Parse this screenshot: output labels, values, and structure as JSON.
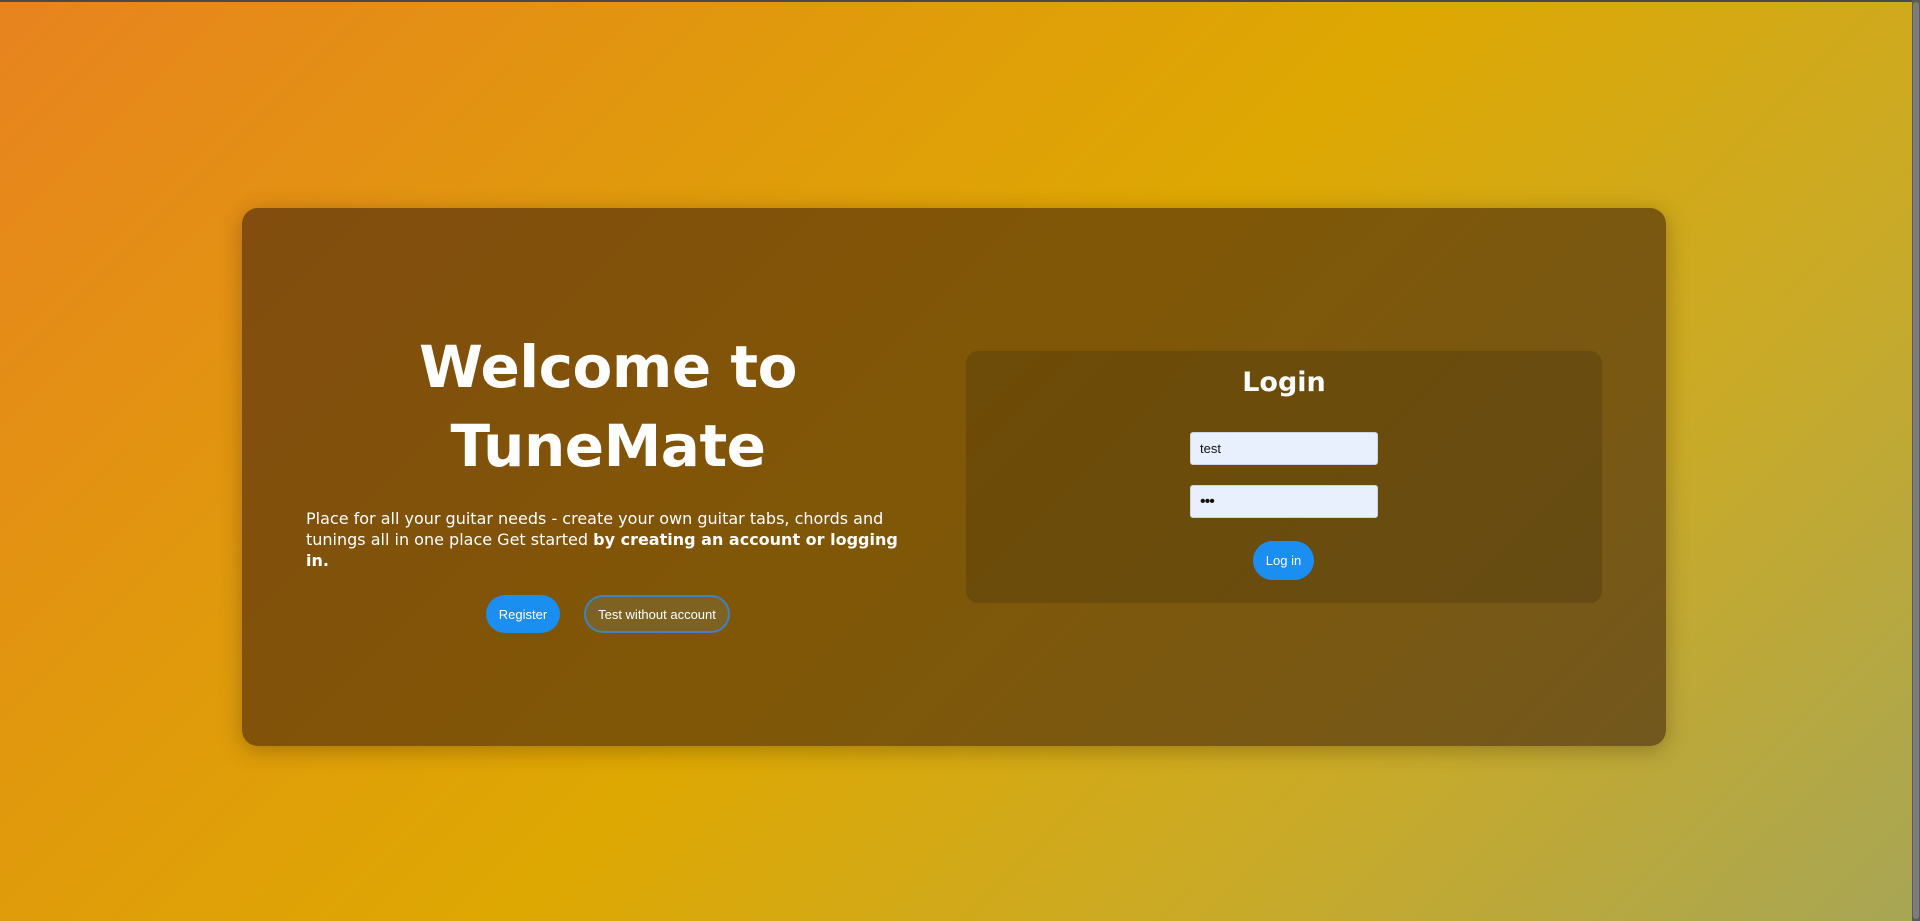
{
  "welcome": {
    "title_line1": "Welcome to",
    "title_line2": "TuneMate",
    "description": "Place for all your guitar needs - create your own guitar tabs, chords and tunings all in one place Get started ",
    "description_bold": "by creating an account or logging in.",
    "register_label": "Register",
    "test_label": "Test without account"
  },
  "login": {
    "title": "Login",
    "username_value": "test",
    "password_mask": "•••",
    "submit_label": "Log in"
  },
  "colors": {
    "gradient_start": "#e8831f",
    "gradient_mid": "#dea802",
    "gradient_end": "#a7a656",
    "button_blue": "#1b8ef2",
    "input_bg": "#e8f0fe"
  }
}
